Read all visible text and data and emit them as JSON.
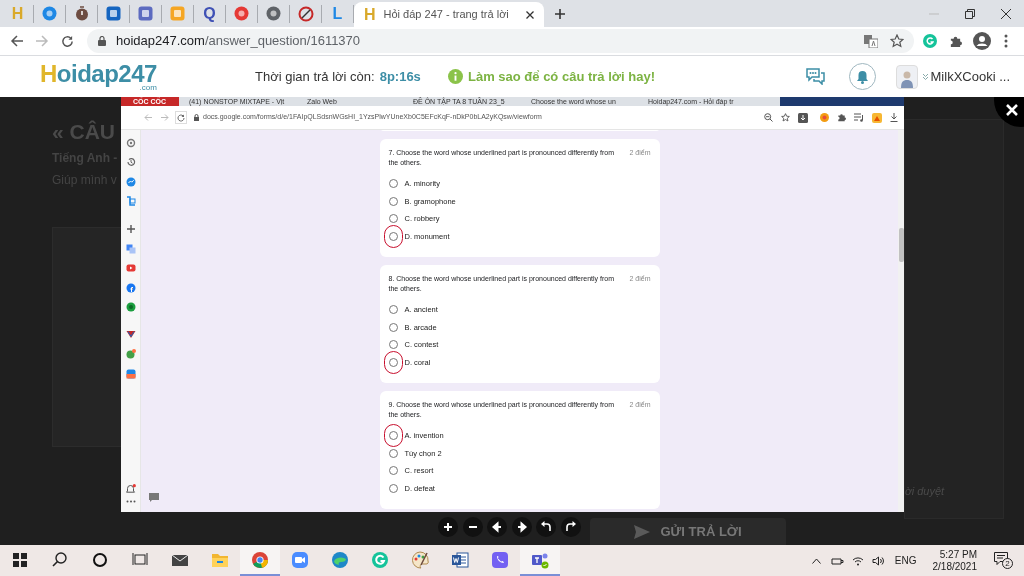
{
  "browser": {
    "pinned_tabs": [
      {
        "kind": "letter",
        "glyph": "H",
        "color": "#d9a92a"
      },
      {
        "kind": "round",
        "color": "#1e88e5"
      },
      {
        "kind": "timer",
        "color": "#6d4c41"
      },
      {
        "kind": "square",
        "color": "#1565c0"
      },
      {
        "kind": "square",
        "color": "#5c6bc0"
      },
      {
        "kind": "square",
        "color": "#f5a623"
      },
      {
        "kind": "letter",
        "glyph": "Q",
        "color": "#3f51b5"
      },
      {
        "kind": "round",
        "color": "#e53935"
      },
      {
        "kind": "round",
        "color": "#5f6368"
      },
      {
        "kind": "ring",
        "color": "#c62828"
      },
      {
        "kind": "letter",
        "glyph": "L",
        "color": "#1e88e5"
      }
    ],
    "active_tab": {
      "favicon": "H",
      "title": "Hỏi đáp 247 - trang trả lời"
    },
    "url_host": "hoidap247.com",
    "url_path": "/answer_question/1611370"
  },
  "site": {
    "logo_initial": "H",
    "logo_rest": "oidap247",
    "logo_suffix": ".com",
    "timer_label": "Thời gian trả lời còn:",
    "timer_value": "8p:16s",
    "tip": "Làm sao để có câu trả lời hay!",
    "username": "MilkXCooki ..."
  },
  "background_page": {
    "title": "« CÂU",
    "subject": "Tiếng Anh -",
    "question": "Giúp mình v",
    "status": "ời duyệt",
    "submit": "GỬI TRẢ LỜI"
  },
  "viewer": {
    "brand": "CỐC CỐC",
    "tabs": [
      "(41) NONSTOP MIXTAPE - Vịt",
      "Zalo Web",
      "ĐỀ ÔN TẬP TA 8 TUẦN 23_5",
      "Choose the word whose un",
      "Hoidap247.com - Hỏi đáp tr"
    ],
    "url": "docs.google.com/forms/d/e/1FAIpQLSdsnWGsHI_1YzsPlwYUneXb0C5EFcKqF-nDkP0bLA2yKQsw/viewform",
    "questions": [
      {
        "text": "7. Choose the word whose underlined part is pronounced differently from the others.",
        "points": "2 điểm",
        "options": [
          {
            "label": "A. minority",
            "selected": false,
            "marked": false
          },
          {
            "label": "B. gramophone",
            "selected": false,
            "marked": false
          },
          {
            "label": "C. robbery",
            "selected": false,
            "marked": false
          },
          {
            "label": "D. monument",
            "selected": false,
            "marked": true
          }
        ]
      },
      {
        "text": "8. Choose the word whose underlined part is pronounced differently from the others.",
        "points": "2 điểm",
        "options": [
          {
            "label": "A. ancient",
            "selected": false,
            "marked": false
          },
          {
            "label": "B. arcade",
            "selected": false,
            "marked": false
          },
          {
            "label": "C. contest",
            "selected": false,
            "marked": false
          },
          {
            "label": "D. coral",
            "selected": false,
            "marked": true
          }
        ]
      },
      {
        "text": "9. Choose the word whose underlined part is pronounced differently from the others.",
        "points": "2 điểm",
        "options": [
          {
            "label": "A. invention",
            "selected": false,
            "marked": true
          },
          {
            "label": "Tùy chọn 2",
            "selected": false,
            "marked": false
          },
          {
            "label": "C. resort",
            "selected": false,
            "marked": false
          },
          {
            "label": "D. defeat",
            "selected": false,
            "marked": false
          }
        ]
      }
    ]
  },
  "taskbar": {
    "apps": [
      {
        "kind": "start",
        "active": false
      },
      {
        "kind": "search",
        "active": false
      },
      {
        "kind": "cortana",
        "active": false
      },
      {
        "kind": "taskview",
        "active": false
      },
      {
        "kind": "mail",
        "active": false
      },
      {
        "kind": "folder",
        "active": false
      },
      {
        "kind": "chrome",
        "active": true
      },
      {
        "kind": "zoom",
        "active": false
      },
      {
        "kind": "edge",
        "active": false
      },
      {
        "kind": "grammarly",
        "active": false
      },
      {
        "kind": "paint",
        "active": false
      },
      {
        "kind": "word",
        "active": false
      },
      {
        "kind": "viber",
        "active": false
      },
      {
        "kind": "teams",
        "active": true
      }
    ],
    "language": "ENG",
    "time": "5:27 PM",
    "date": "2/18/2021",
    "notifications": "2"
  }
}
